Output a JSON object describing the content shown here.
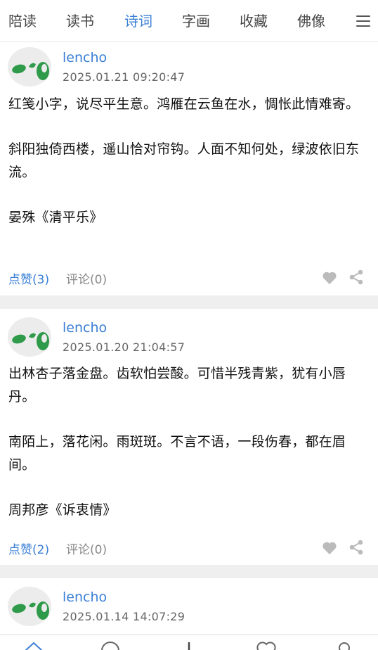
{
  "nav": {
    "tabs": [
      {
        "label": "陪读"
      },
      {
        "label": "读书"
      },
      {
        "label": "诗词"
      },
      {
        "label": "字画"
      },
      {
        "label": "收藏"
      },
      {
        "label": "佛像"
      }
    ],
    "active_tab": "诗词",
    "menu_icon": "menu-icon"
  },
  "posts": [
    {
      "author": "lencho",
      "time": "2025.01.21 09:20:47",
      "lines": [
        "红笺小字，说尽平生意。鸿雁在云鱼在水，惆怅此情难寄。",
        "斜阳独倚西楼，遥山恰对帘钩。人面不知何处，绿波依旧东流。",
        "晏殊《清平乐》"
      ],
      "likes": "点赞(3)",
      "comments": "评论(0)"
    },
    {
      "author": "lencho",
      "time": "2025.01.20 21:04:57",
      "lines": [
        "出林杏子落金盘。齿软怕尝酸。可惜半残青紫，犹有小唇丹。",
        "南陌上，落花闲。雨斑斑。不言不语，一段伤春，都在眉间。",
        "周邦彦《诉衷情》"
      ],
      "likes": "点赞(2)",
      "comments": "评论(0)"
    },
    {
      "author": "lencho",
      "time": "2025.01.14 14:07:29"
    }
  ],
  "colors": {
    "accent": "#3a7fd5",
    "separator": "#efefef",
    "icon_gray": "#bbbbbb",
    "avatar_green": "#2e9a4a"
  }
}
